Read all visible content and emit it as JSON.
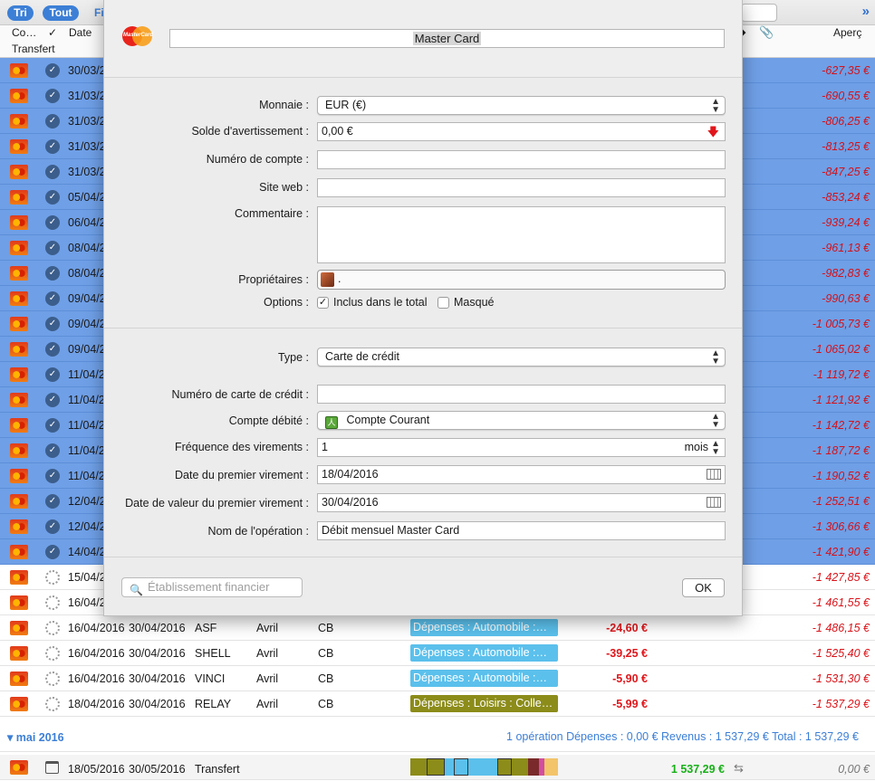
{
  "toolbar": {
    "sort_label": "Tri",
    "all_label": "Tout",
    "filter_label": "Fi",
    "nav_icon": "double-chevron-right-icon"
  },
  "columns": {
    "co": "Co…",
    "check": "✓",
    "date": "Date",
    "transfer": "Transfert",
    "preview": "Aperç"
  },
  "rows_selected": [
    {
      "date": "30/03/2",
      "balance": "-627,35 €"
    },
    {
      "date": "31/03/2",
      "balance": "-690,55 €"
    },
    {
      "date": "31/03/2",
      "balance": "-806,25 €"
    },
    {
      "date": "31/03/2",
      "balance": "-813,25 €"
    },
    {
      "date": "31/03/2",
      "balance": "-847,25 €"
    },
    {
      "date": "05/04/2",
      "balance": "-853,24 €"
    },
    {
      "date": "06/04/2",
      "balance": "-939,24 €"
    },
    {
      "date": "08/04/2",
      "balance": "-961,13 €"
    },
    {
      "date": "08/04/2",
      "balance": "-982,83 €"
    },
    {
      "date": "09/04/2",
      "balance": "-990,63 €"
    },
    {
      "date": "09/04/2",
      "balance": "-1 005,73 €"
    },
    {
      "date": "09/04/2",
      "balance": "-1 065,02 €"
    },
    {
      "date": "11/04/2",
      "balance": "-1 119,72 €"
    },
    {
      "date": "11/04/2",
      "balance": "-1 121,92 €"
    },
    {
      "date": "11/04/2",
      "balance": "-1 142,72 €"
    },
    {
      "date": "11/04/2",
      "balance": "-1 187,72 €"
    },
    {
      "date": "11/04/2",
      "balance": "-1 190,52 €"
    },
    {
      "date": "12/04/2",
      "balance": "-1 252,51 €"
    },
    {
      "date": "12/04/2",
      "balance": "-1 306,66 €"
    },
    {
      "date": "14/04/2",
      "balance": "-1 421,90 €"
    }
  ],
  "rows_pending": [
    {
      "date": "15/04/2",
      "balance": "-1 427,85 €"
    },
    {
      "date": "16/04/2",
      "balance": "-1 461,55 €"
    }
  ],
  "rows_full": [
    {
      "date": "16/04/2016",
      "value_date": "30/04/2016",
      "desc": "ASF",
      "month": "Avril",
      "mode": "CB",
      "tag": "Dépenses : Automobile :…",
      "tag_kind": "auto",
      "amount": "-24,60 €",
      "balance": "-1 486,15 €"
    },
    {
      "date": "16/04/2016",
      "value_date": "30/04/2016",
      "desc": "SHELL",
      "month": "Avril",
      "mode": "CB",
      "tag": "Dépenses : Automobile :…",
      "tag_kind": "auto",
      "amount": "-39,25 €",
      "balance": "-1 525,40 €"
    },
    {
      "date": "16/04/2016",
      "value_date": "30/04/2016",
      "desc": "VINCI",
      "month": "Avril",
      "mode": "CB",
      "tag": "Dépenses : Automobile :…",
      "tag_kind": "auto",
      "amount": "-5,90 €",
      "balance": "-1 531,30 €"
    },
    {
      "date": "18/04/2016",
      "value_date": "30/04/2016",
      "desc": "RELAY",
      "month": "Avril",
      "mode": "CB",
      "tag": "Dépenses : Loisirs : Colle…",
      "tag_kind": "loisir",
      "amount": "-5,99 €",
      "balance": "-1 537,29 €"
    }
  ],
  "group": {
    "title": "mai 2016",
    "summary": "1 opération   Dépenses : 0,00 €   Revenus : 1 537,29 €   Total : 1 537,29 €"
  },
  "transfer_row": {
    "date": "18/05/2016",
    "value_date": "30/05/2016",
    "desc": "Transfert",
    "amount": "1 537,29 €",
    "balance": "0,00 €"
  },
  "sheet": {
    "account_name": "Master Card",
    "labels": {
      "currency": "Monnaie :",
      "warning_balance": "Solde d'avertissement :",
      "account_number": "Numéro de compte :",
      "website": "Site web :",
      "comment": "Commentaire :",
      "owners": "Propriétaires :",
      "options": "Options :",
      "type": "Type :",
      "card_number": "Numéro de carte de crédit :",
      "debited_account": "Compte débité :",
      "frequency": "Fréquence des virements :",
      "first_transfer_date": "Date du premier virement :",
      "first_value_date": "Date de valeur du premier virement :",
      "operation_name": "Nom de l'opération :"
    },
    "values": {
      "currency": "EUR (€)",
      "warning_balance": "0,00 €",
      "account_number": "",
      "website": "",
      "owner": ".",
      "include_total": "Inclus dans le total",
      "hidden": "Masqué",
      "type": "Carte de crédit",
      "card_number": "",
      "debited_account": "Compte Courant",
      "frequency": "1",
      "frequency_unit": "mois",
      "first_transfer_date": "18/04/2016",
      "first_value_date": "30/04/2016",
      "operation_name": "Débit mensuel Master Card"
    },
    "include_total_checked": true,
    "hidden_checked": false,
    "search_placeholder": "Établissement financier",
    "ok_label": "OK"
  },
  "colors": {
    "accent": "#3c7fd6",
    "selection": "#6f9fe6",
    "negative": "#e0161b",
    "positive": "#18b018"
  }
}
